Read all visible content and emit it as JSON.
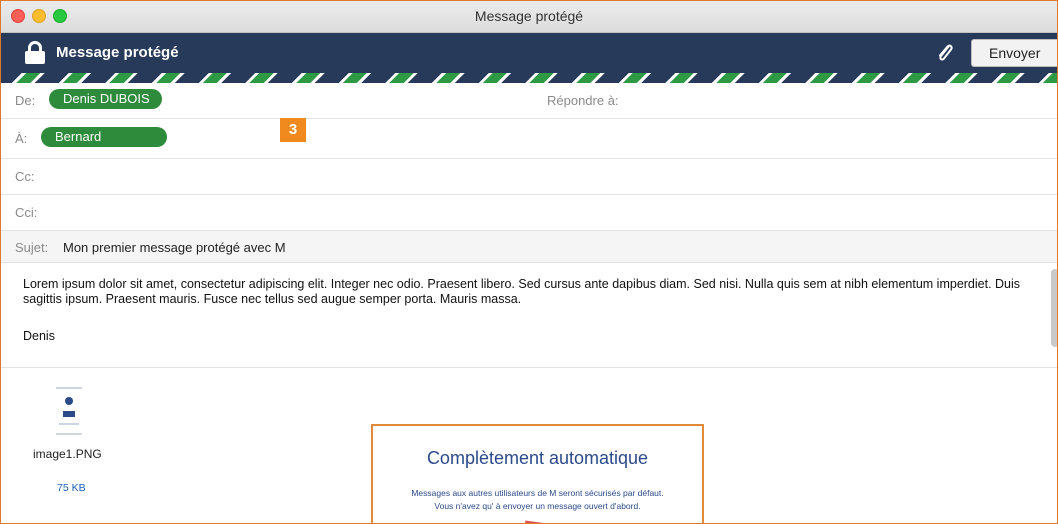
{
  "window": {
    "title": "Message protégé"
  },
  "toolbar": {
    "title": "Message protégé",
    "lock_icon": "lock-icon",
    "attach_icon": "paperclip-icon",
    "send_label": "Envoyer"
  },
  "fields": {
    "from_label": "De:",
    "from_value": "Denis DUBOIS",
    "reply_to_label": "Répondre à:",
    "to_label": "À:",
    "to_value": "Bernard",
    "cc_label": "Cc:",
    "bcc_label": "Cci:",
    "subject_label": "Sujet:",
    "subject_value": "Mon premier message protégé avec M"
  },
  "annotation_badge": "3",
  "message": {
    "body": "Lorem ipsum dolor sit amet, consectetur adipiscing elit. Integer nec odio. Praesent libero. Sed cursus ante dapibus diam. Sed nisi. Nulla quis sem at nibh elementum imperdiet. Duis sagittis ipsum. Praesent mauris. Fusce nec tellus sed augue semper porta. Mauris massa.",
    "signature": "Denis"
  },
  "attachment": {
    "name": "image1.PNG",
    "size": "75 KB"
  },
  "embedded_image": {
    "title": "Complètement automatique",
    "line1": "Messages aux autres utilisateurs de M seront sécurisés par défaut.",
    "line2": "Vous n'avez qu' à envoyer un message ouvert d'abord."
  },
  "colors": {
    "toolbar_bg": "#273a5a",
    "pill_green": "#2e8b3c",
    "badge_orange": "#f08a1e",
    "highlight_border": "#e08a3a"
  }
}
